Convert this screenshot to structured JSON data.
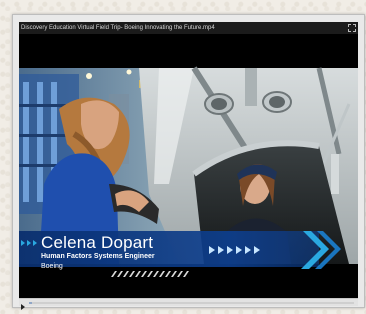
{
  "player": {
    "title": "Discovery Education Virtual Field Trip- Boeing Innovating the Future.mp4",
    "progress_fraction": 0.01
  },
  "lower_third": {
    "name": "Celena Dopart",
    "role": "Human Factors Systems Engineer",
    "organization": "Boeing"
  },
  "icons": {
    "fullscreen": "fullscreen-icon",
    "play": "play-icon"
  },
  "colors": {
    "brand_blue": "#0b3a8c",
    "accent_cyan": "#2aa8e0",
    "title_bar": "#1b1b1b"
  }
}
